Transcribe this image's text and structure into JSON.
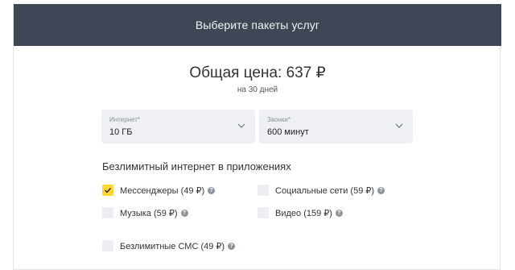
{
  "header": {
    "title": "Выберите пакеты услуг"
  },
  "summary": {
    "price": "Общая цена: 637 ₽",
    "period": "на 30 дней"
  },
  "selects": {
    "internet": {
      "label": "Интернет*",
      "value": "10 ГБ"
    },
    "calls": {
      "label": "Звонки*",
      "value": "600 минут"
    }
  },
  "unlimited_apps": {
    "title": "Безлимитный интернет в приложениях",
    "options": [
      {
        "label": "Мессенджеры (49 ₽)",
        "checked": true
      },
      {
        "label": "Социальные сети (59 ₽)",
        "checked": false
      },
      {
        "label": "Музыка (59 ₽)",
        "checked": false
      },
      {
        "label": "Видео (159 ₽)",
        "checked": false
      }
    ]
  },
  "sms": {
    "label": "Безлимитные СМС (49 ₽)",
    "checked": false
  },
  "colors": {
    "header_bg": "#3f4756",
    "checkbox_checked": "#ffd633",
    "select_bg": "#eef0f4"
  },
  "icons": {
    "chevron": "chevron-down-icon",
    "help": "question-circle-icon",
    "check": "checkmark-icon"
  }
}
